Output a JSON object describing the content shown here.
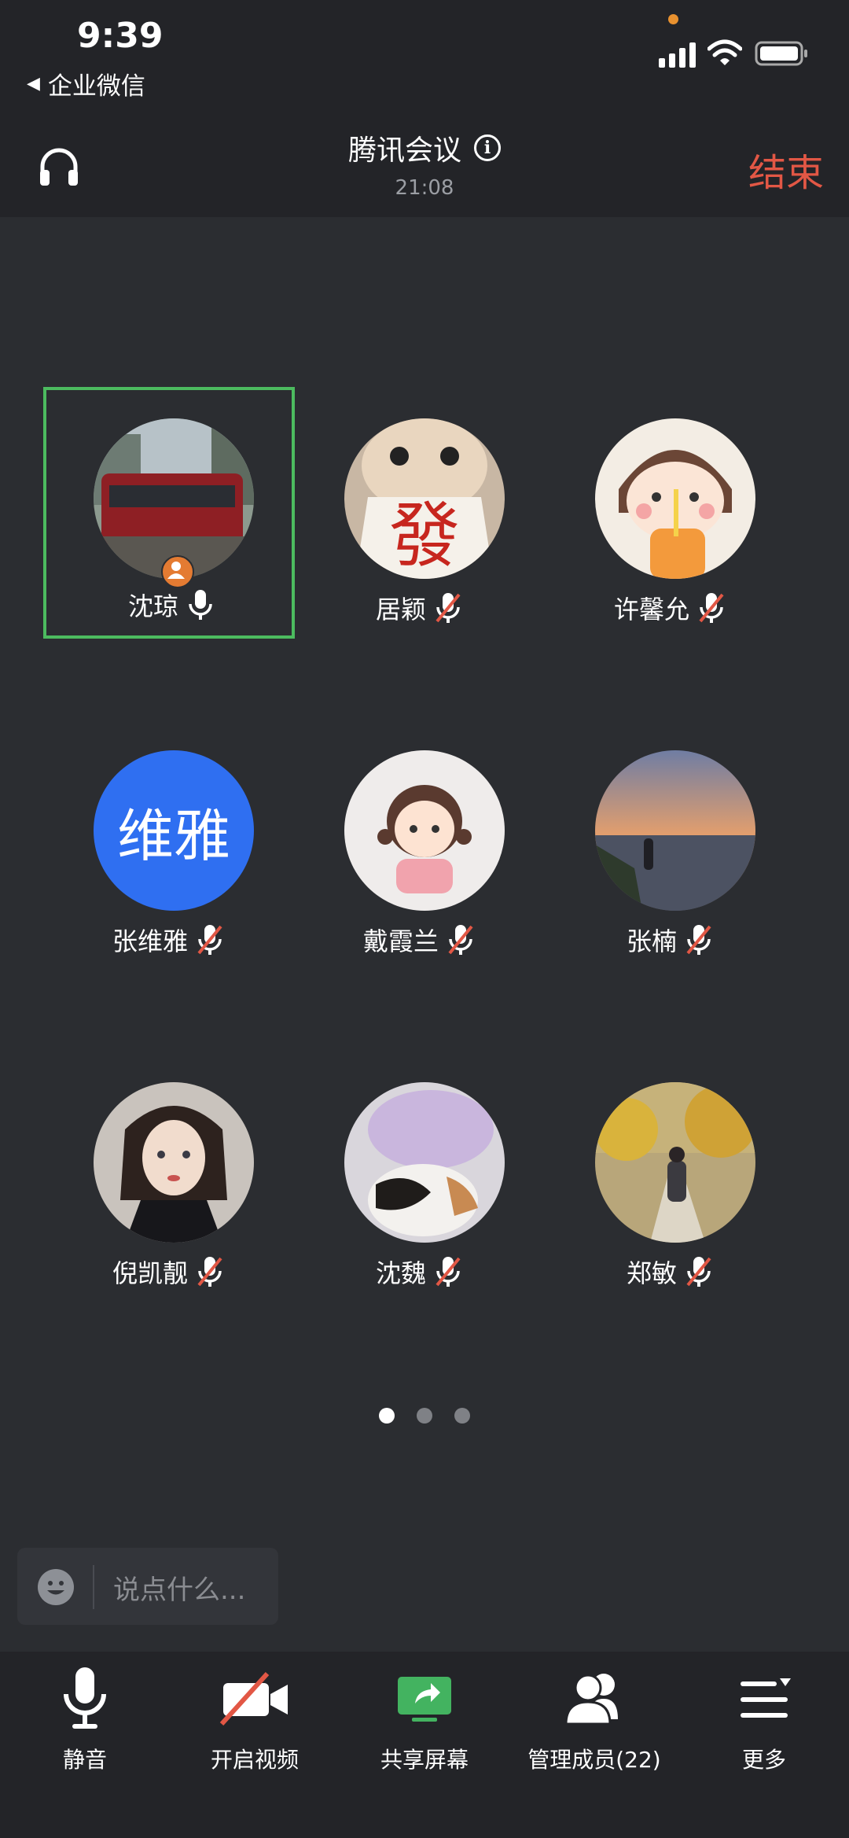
{
  "status_bar": {
    "time": "9:39",
    "back_app": "企业微信"
  },
  "header": {
    "title": "腾讯会议",
    "duration": "21:08",
    "end_label": "结束"
  },
  "participants": [
    {
      "name": "沈琼",
      "muted": false
    },
    {
      "name": "居颖",
      "muted": true
    },
    {
      "name": "许馨允",
      "muted": true
    },
    {
      "name": "张维雅",
      "muted": true,
      "avatar_text": "维雅"
    },
    {
      "name": "戴霞兰",
      "muted": true
    },
    {
      "name": "张楠",
      "muted": true
    },
    {
      "name": "倪凯靓",
      "muted": true
    },
    {
      "name": "沈魏",
      "muted": true
    },
    {
      "name": "郑敏",
      "muted": true
    }
  ],
  "pager": {
    "pages": 3,
    "current": 1
  },
  "chat": {
    "placeholder": "说点什么..."
  },
  "toolbar": {
    "mute": "静音",
    "video": "开启视频",
    "share": "共享屏幕",
    "members": "管理成员(22)",
    "more": "更多"
  },
  "colors": {
    "end": "#e25745",
    "active_border": "#4cbb5f",
    "share_green": "#43b360"
  }
}
